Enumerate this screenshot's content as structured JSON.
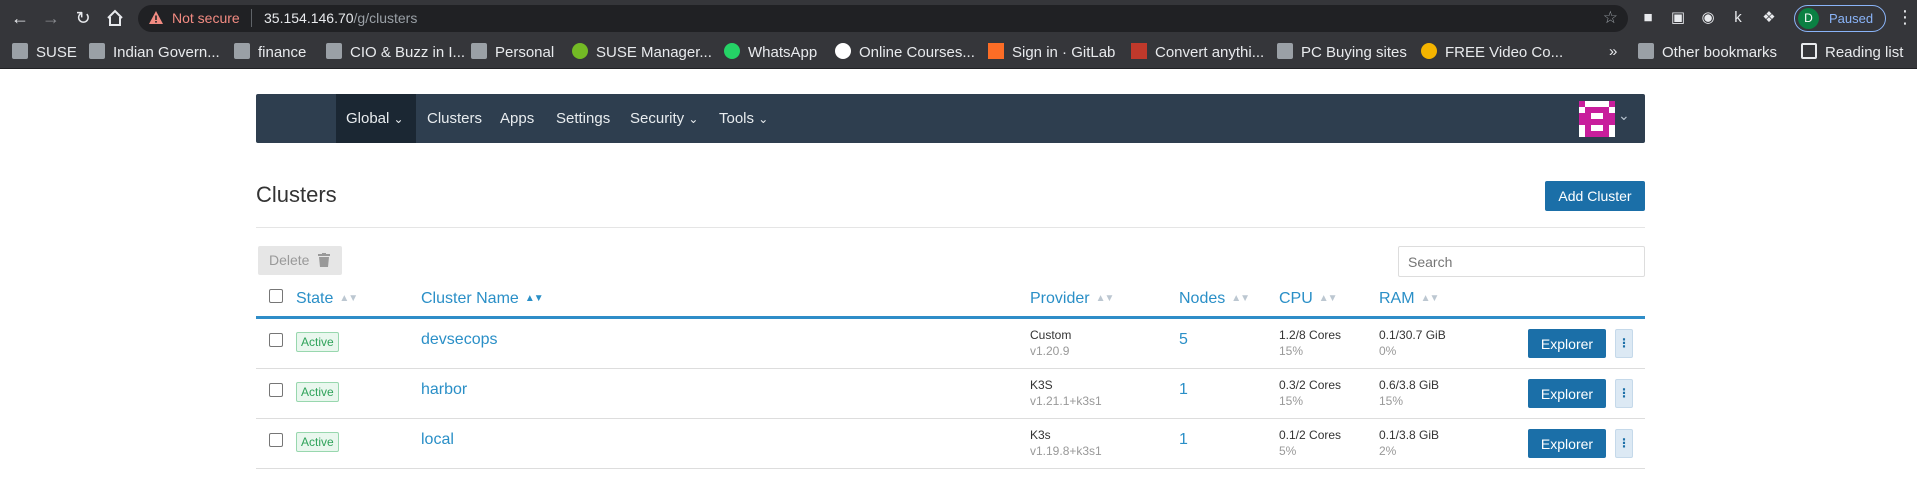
{
  "browser": {
    "security_label": "Not secure",
    "url_host": "35.154.146.70",
    "url_path": "/g/clusters",
    "profile_initial": "D",
    "profile_status": "Paused",
    "ext_k": "k",
    "bookmarks": [
      {
        "label": "SUSE",
        "icon": "folder-icon"
      },
      {
        "label": "Indian Govern...",
        "icon": "folder-icon"
      },
      {
        "label": "finance",
        "icon": "folder-icon"
      },
      {
        "label": "CIO & Buzz in I...",
        "icon": "folder-icon"
      },
      {
        "label": "Personal",
        "icon": "folder-icon"
      },
      {
        "label": "SUSE Manager...",
        "icon": "suse-icon"
      },
      {
        "label": "WhatsApp",
        "icon": "whatsapp-icon"
      },
      {
        "label": "Online Courses...",
        "icon": "udemy-icon"
      },
      {
        "label": "Sign in · GitLab",
        "icon": "gitlab-icon"
      },
      {
        "label": "Convert anythi...",
        "icon": "png-pdf-icon"
      },
      {
        "label": "PC Buying sites",
        "icon": "folder-icon"
      },
      {
        "label": "FREE Video Co...",
        "icon": "video-icon"
      }
    ],
    "more_bookmarks": "»",
    "other_bookmarks": "Other bookmarks",
    "reading_list": "Reading list"
  },
  "header": {
    "nav": {
      "global": "Global",
      "clusters": "Clusters",
      "apps": "Apps",
      "settings": "Settings",
      "security": "Security",
      "tools": "Tools"
    }
  },
  "page": {
    "title": "Clusters",
    "add_button": "Add Cluster",
    "delete_button": "Delete",
    "search_placeholder": "Search"
  },
  "table": {
    "columns": {
      "state": "State",
      "name": "Cluster Name",
      "provider": "Provider",
      "nodes": "Nodes",
      "cpu": "CPU",
      "ram": "RAM"
    },
    "rows": [
      {
        "state": "Active",
        "name": "devsecops",
        "provider": "Custom",
        "provider_version": "v1.20.9",
        "nodes": "5",
        "cpu": "1.2/8 Cores",
        "cpu_pct": "15%",
        "ram": "0.1/30.7 GiB",
        "ram_pct": "0%",
        "action": "Explorer"
      },
      {
        "state": "Active",
        "name": "harbor",
        "provider": "K3S",
        "provider_version": "v1.21.1+k3s1",
        "nodes": "1",
        "cpu": "0.3/2 Cores",
        "cpu_pct": "15%",
        "ram": "0.6/3.8 GiB",
        "ram_pct": "15%",
        "action": "Explorer"
      },
      {
        "state": "Active",
        "name": "local",
        "provider": "K3s",
        "provider_version": "v1.19.8+k3s1",
        "nodes": "1",
        "cpu": "0.1/2 Cores",
        "cpu_pct": "5%",
        "ram": "0.1/3.8 GiB",
        "ram_pct": "2%",
        "action": "Explorer"
      }
    ]
  },
  "colors": {
    "header_bg": "#2e3e4f",
    "accent": "#1b6fa8",
    "link": "#2a8fc7",
    "active_badge": "#2fa35a"
  }
}
